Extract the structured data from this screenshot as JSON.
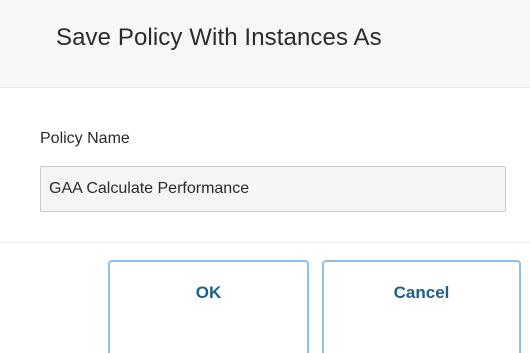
{
  "dialog": {
    "title": "Save Policy With Instances As"
  },
  "form": {
    "policy_name_label": "Policy Name",
    "policy_name_value": "GAA Calculate Performance"
  },
  "buttons": {
    "ok_label": "OK",
    "cancel_label": "Cancel"
  },
  "colors": {
    "header_background": "#f7f7f7",
    "button_border": "#8fbfe3",
    "button_text": "#1e5f8c",
    "input_background": "#f5f5f5"
  }
}
